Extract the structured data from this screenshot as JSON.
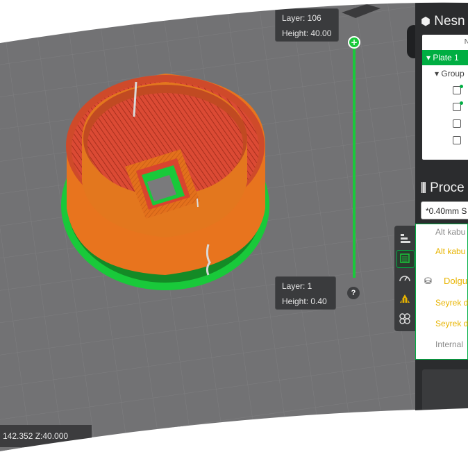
{
  "viewport": {
    "layer_top": {
      "layer_label": "Layer: 106",
      "height_label": "Height: 40.00"
    },
    "layer_bottom": {
      "layer_label": "Layer: 1",
      "height_label": "Height: 0.40"
    },
    "coordinates_text": "142.352  Z:40.000",
    "help_label": "?",
    "slider_add_label": "+"
  },
  "objects_panel": {
    "title": "Nesn",
    "header_fragment": "N",
    "plate_label": "Plate 1",
    "group_label": "Group"
  },
  "process_panel": {
    "title": "Proce",
    "preset_value": "*0.40mm S",
    "rows": [
      {
        "label": "Alt kabu"
      },
      {
        "label": "Alt kabu"
      },
      {
        "label": "Dolgu"
      },
      {
        "label": "Seyrek d"
      },
      {
        "label": "Seyrek d"
      },
      {
        "label": "Internal"
      }
    ]
  },
  "side_tabs": [
    "layers-icon",
    "infill-icon",
    "speed-icon",
    "support-icon",
    "others-icon"
  ],
  "colors": {
    "accent_green": "#00ae42",
    "wall_orange": "#e8741e",
    "infill_red": "#d9442e",
    "bed_gray": "#727274",
    "highlight_yellow": "#e8b400"
  }
}
